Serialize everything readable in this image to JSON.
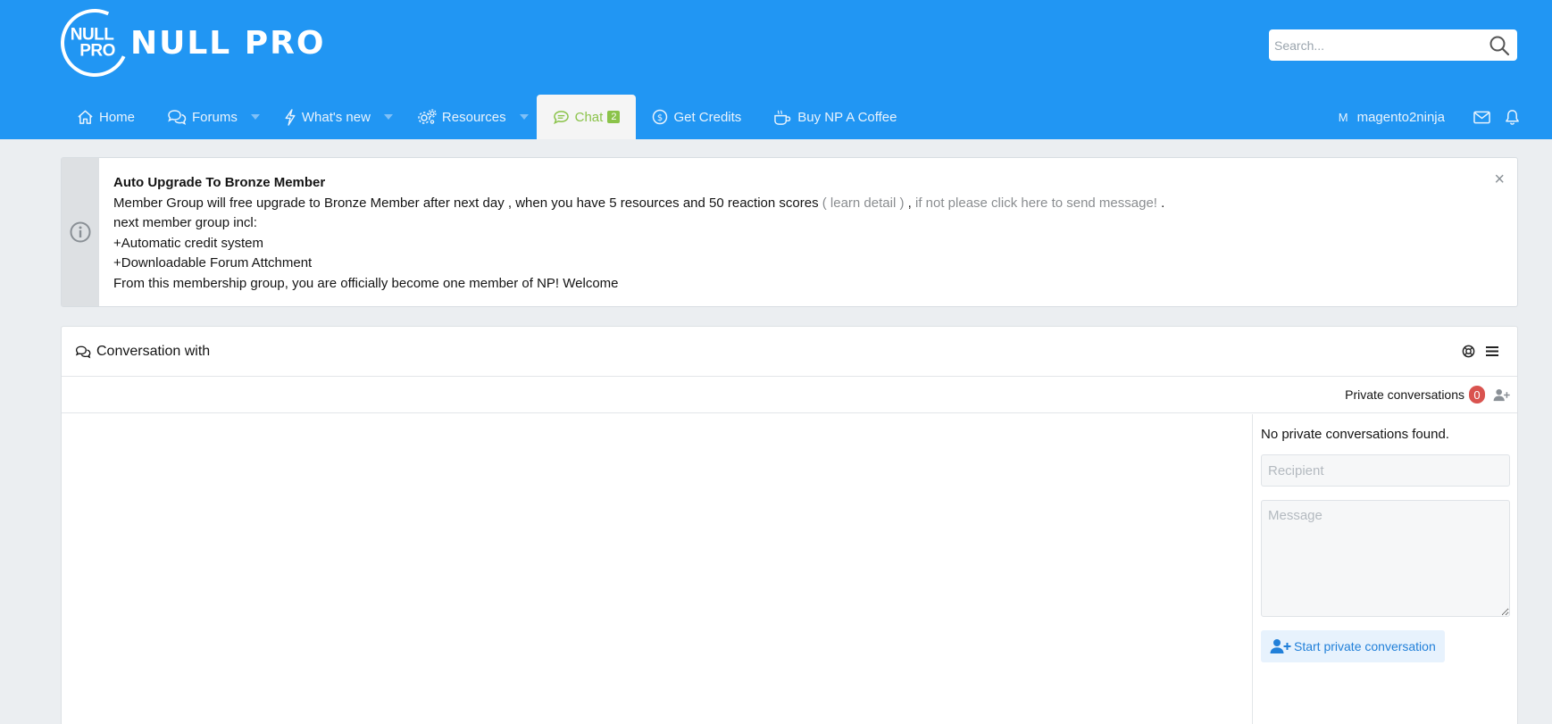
{
  "brand": {
    "badge_line1": "NULL",
    "badge_line2": "PRO",
    "name": "NULL PRO",
    "header_color": "#2196f3"
  },
  "search": {
    "placeholder": "Search..."
  },
  "nav": {
    "home": "Home",
    "forums": "Forums",
    "whats_new": "What's new",
    "resources": "Resources",
    "chat": "Chat",
    "chat_count": "2",
    "get_credits": "Get Credits",
    "buy_coffee": "Buy NP A Coffee"
  },
  "user": {
    "avatar_letter": "M",
    "username": "magento2ninja"
  },
  "notice": {
    "title": "Auto Upgrade To Bronze Member",
    "line1_text": "Member Group will free upgrade to Bronze Member after next day , when you have 5 resources and 50 reaction scores ",
    "learn_detail": "( learn detail )",
    "separator": " , ",
    "send_message": "if not please click here to send message!",
    "line1_end": " .",
    "line2": "next member group incl:",
    "line3": "+Automatic credit system",
    "line4": "+Downloadable Forum Attchment",
    "line5": "From this membership group, you are officially become one member of NP! Welcome",
    "close": "×"
  },
  "conversation": {
    "title": "Conversation with",
    "private_label": "Private conversations",
    "private_count": "0",
    "empty_text": "No private conversations found.",
    "recipient_placeholder": "Recipient",
    "message_placeholder": "Message",
    "start_button": "Start private conversation"
  }
}
